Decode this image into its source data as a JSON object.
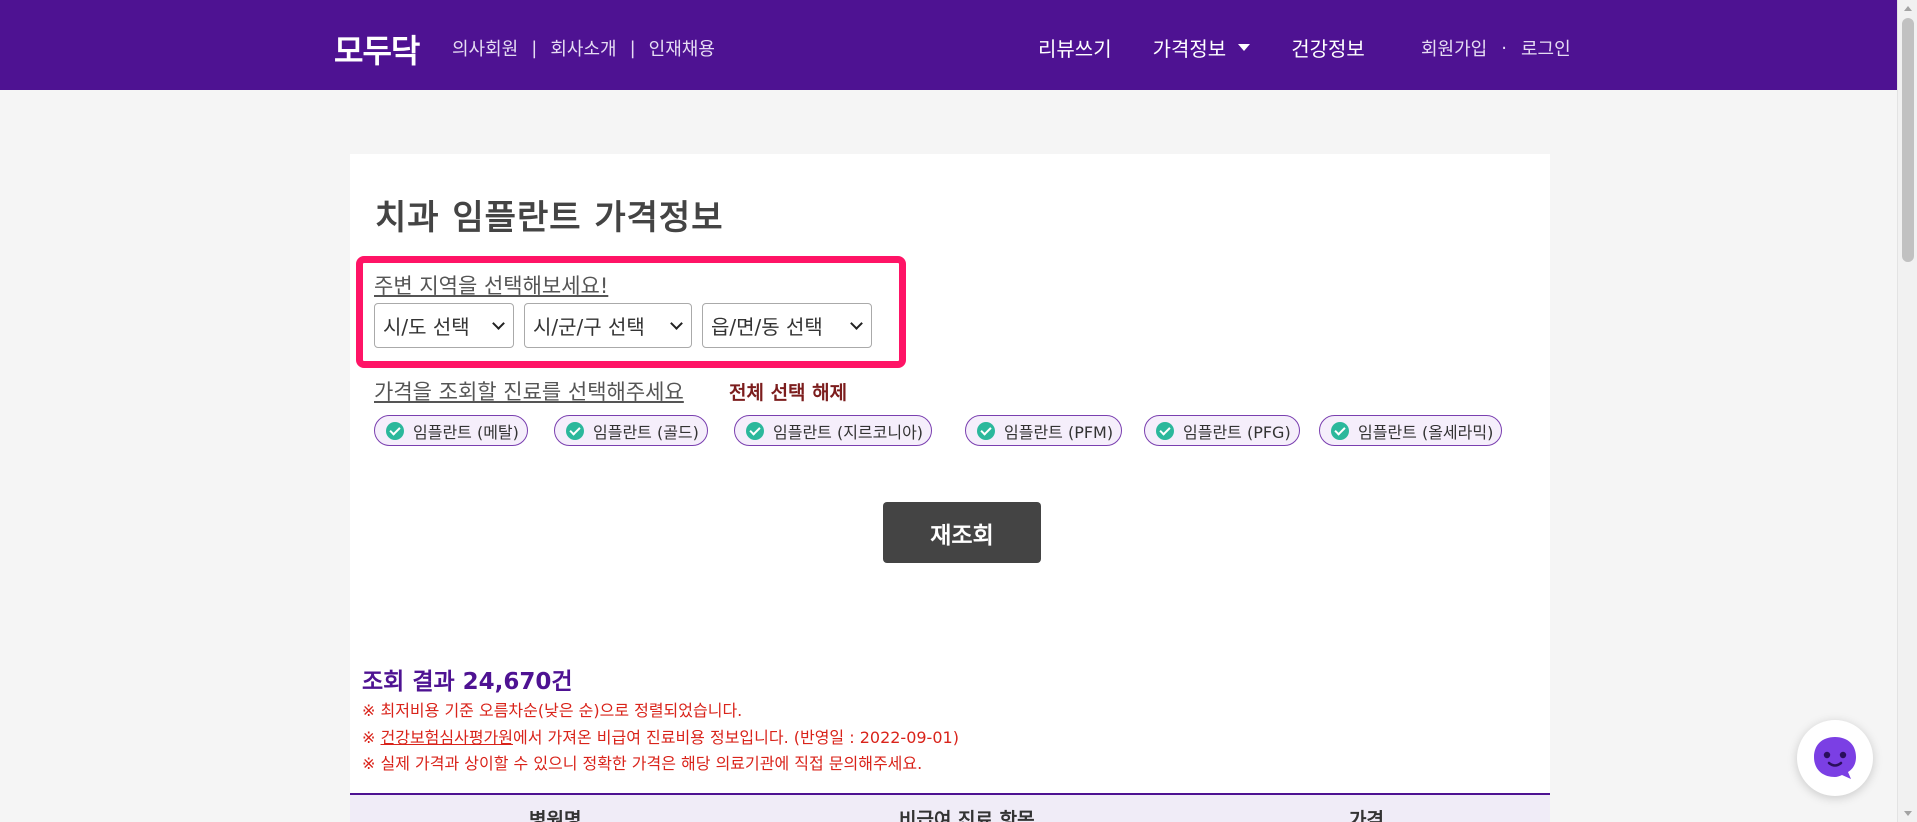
{
  "header": {
    "logo": "모두닥",
    "nav_left": [
      "의사회원",
      "회사소개",
      "인재채용"
    ],
    "nav_separator": "|",
    "nav_right": {
      "review": "리뷰쓰기",
      "price_info": "가격정보",
      "health_info": "건강정보"
    },
    "auth": {
      "signup": "회원가입",
      "dot": "·",
      "login": "로그인"
    }
  },
  "page": {
    "title": "치과 임플란트 가격정보",
    "region_label": "주변 지역을 선택해보세요!",
    "selects": {
      "sido": "시/도 선택",
      "sigungu": "시/군/구 선택",
      "eupmyeondong": "읍/면/동 선택"
    },
    "treatment_label": "가격을 조회할 진료를 선택해주세요",
    "deselect_all": "전체 선택 해제",
    "chips": [
      "임플란트 (메탈)",
      "임플란트 (골드)",
      "임플란트 (지르코니아)",
      "임플란트 (PFM)",
      "임플란트 (PFG)",
      "임플란트 (올세라믹)"
    ],
    "requery_button": "재조회",
    "result_title": "조회 결과 24,670건",
    "notes": {
      "note1": "※ 최저비용 기준 오름차순(낮은 순)으로 정렬되었습니다.",
      "note2_prefix": "※ ",
      "note2_link": "건강보험심사평가원",
      "note2_suffix": "에서 가져온 비급여 진료비용 정보입니다. (반영일 : 2022-09-01)",
      "note3": "※ 실제 가격과 상이할 수 있으니 정확한 가격은 해당 의료기관에 직접 문의해주세요."
    },
    "table_headers": [
      "병원명",
      "비급여 진료 항목",
      "가격"
    ]
  },
  "icons": {
    "check": "check-circle-icon",
    "chat": "chat-bot-icon",
    "caret": "caret-down-icon"
  },
  "colors": {
    "brand": "#4e1292",
    "highlight": "#ff1466",
    "check": "#2bb89c",
    "note": "#d9231a"
  }
}
